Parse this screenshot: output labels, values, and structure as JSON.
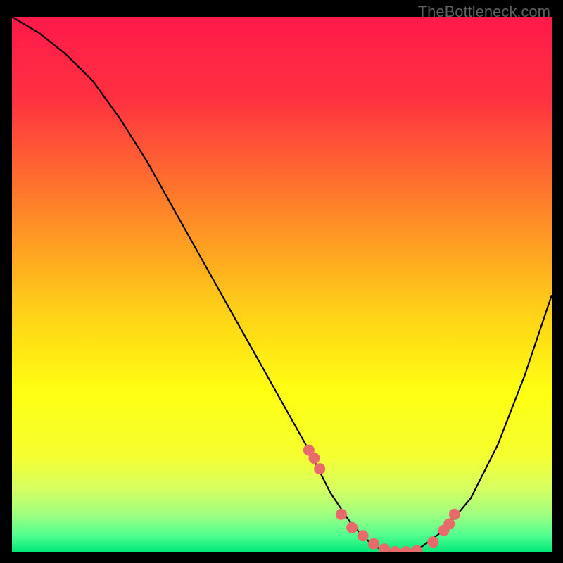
{
  "watermark": "TheBottleneck.com",
  "chart_data": {
    "type": "line",
    "title": "",
    "xlabel": "",
    "ylabel": "",
    "xlim": [
      0,
      100
    ],
    "ylim": [
      0,
      100
    ],
    "background_gradient": {
      "stops": [
        {
          "offset": 0,
          "color": "#ff1a4a"
        },
        {
          "offset": 15,
          "color": "#ff3040"
        },
        {
          "offset": 35,
          "color": "#ff802a"
        },
        {
          "offset": 55,
          "color": "#ffd017"
        },
        {
          "offset": 70,
          "color": "#ffff12"
        },
        {
          "offset": 82,
          "color": "#f5ff30"
        },
        {
          "offset": 88,
          "color": "#d8ff60"
        },
        {
          "offset": 93,
          "color": "#a0ff80"
        },
        {
          "offset": 97,
          "color": "#50ff90"
        },
        {
          "offset": 100,
          "color": "#00e878"
        }
      ]
    },
    "series": [
      {
        "name": "bottleneck-curve",
        "color": "#000000",
        "x": [
          0,
          5,
          10,
          15,
          20,
          25,
          30,
          35,
          40,
          45,
          50,
          55,
          57,
          59,
          61,
          63,
          65,
          67,
          70,
          73,
          76,
          80,
          85,
          90,
          95,
          100
        ],
        "values": [
          100,
          97,
          93,
          88,
          81,
          73,
          64,
          55,
          46,
          37,
          28,
          19,
          15,
          11,
          8,
          5,
          3,
          1,
          0,
          0,
          1,
          4,
          10,
          20,
          33,
          48
        ]
      }
    ],
    "markers": {
      "name": "highlight-points",
      "color": "#e96a6a",
      "radius": 8,
      "x": [
        55,
        56,
        57,
        61,
        63,
        65,
        67,
        69,
        71,
        73,
        75,
        78,
        80,
        81,
        82
      ],
      "values": [
        19,
        17.5,
        15.5,
        7,
        4.5,
        3,
        1.5,
        0.5,
        0,
        0,
        0.2,
        1.8,
        4,
        5.2,
        7
      ]
    }
  }
}
